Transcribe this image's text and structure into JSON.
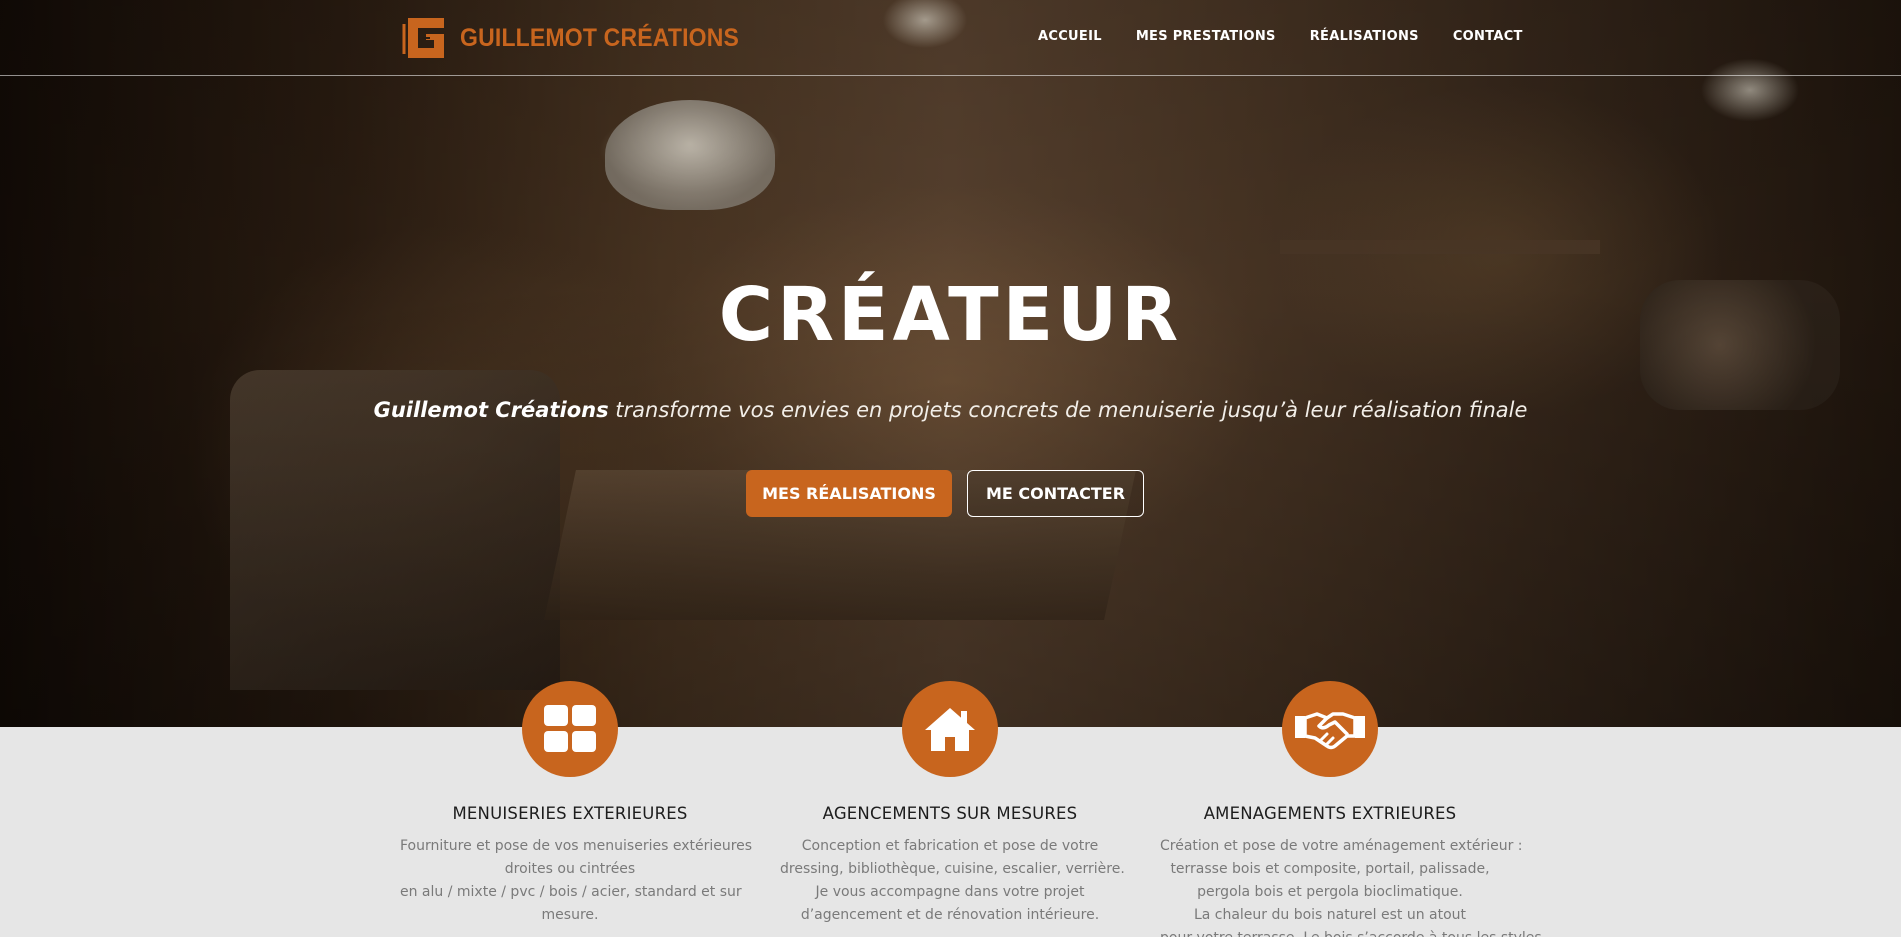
{
  "brand": {
    "name": "GUILLEMOT CRÉATIONS",
    "color": "#c8651e"
  },
  "nav": {
    "items": [
      {
        "label": "ACCUEIL"
      },
      {
        "label": "MES PRESTATIONS"
      },
      {
        "label": "RÉALISATIONS"
      },
      {
        "label": "CONTACT"
      }
    ]
  },
  "hero": {
    "title": "CRÉATEUR",
    "subtitle_strong": "Guillemot Créations",
    "subtitle_rest": " transforme vos envies en projets concrets de menuiserie jusqu’à leur réalisation finale",
    "primary_button": "MES RÉALISATIONS",
    "secondary_button": "ME CONTACTER"
  },
  "services": [
    {
      "icon": "window-grid-icon",
      "title": "MENUISERIES EXTERIEURES",
      "lines": [
        "Fourniture et pose de vos menuiseries extérieures",
        "droites ou cintrées",
        "en alu / mixte / pvc / bois / acier, standard et sur",
        "mesure."
      ]
    },
    {
      "icon": "house-icon",
      "title": "AGENCEMENTS SUR MESURES",
      "lines": [
        "Conception et fabrication et pose de votre",
        "dressing, bibliothèque, cuisine, escalier, verrière.",
        "Je vous accompagne dans votre projet",
        "d’agencement et de rénovation intérieure."
      ]
    },
    {
      "icon": "handshake-icon",
      "title": "AMENAGEMENTS EXTRIEURES",
      "lines": [
        "Création et pose de votre aménagement extérieur :",
        "terrasse bois et composite, portail, palissade,",
        "pergola bois et pergola bioclimatique.",
        "La chaleur du bois naturel est un atout",
        "pour votre terrasse. Le bois s’accorde à tous les styles"
      ]
    }
  ],
  "colors": {
    "accent": "#c8651e",
    "section_bg": "#e6e6e6"
  }
}
